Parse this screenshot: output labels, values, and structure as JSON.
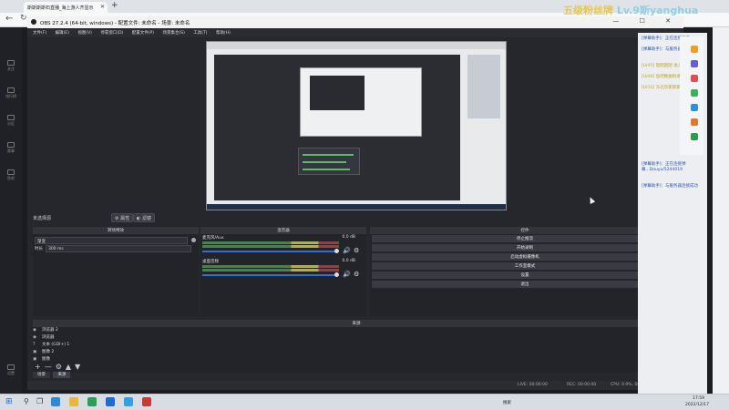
{
  "browser": {
    "tab_title": "斯斯斯斯石直播_海上游人齐显示",
    "new_tab": "+",
    "back": "←",
    "refresh": "↻"
  },
  "banner": {
    "part1": "五级粉丝牌",
    "part2": "Lv.9斯yanghua"
  },
  "obs": {
    "title": "OBS 27.2.4 (64-bit, windows) - 配置文件: 未命名 - 场景: 未命名",
    "window_controls": "— ☐ ✕",
    "menu": [
      "文件(F)",
      "编辑(E)",
      "视图(V)",
      "停靠窗口(D)",
      "配置文件(P)",
      "场景集合(S)",
      "工具(T)",
      "帮助(H)"
    ],
    "no_source": "未选择源",
    "properties_btn": "属性",
    "filters_btn": "滤镜",
    "transition_dock": {
      "header": "转场特效",
      "type": "渐变",
      "duration_label": "时长",
      "duration_value": "300 ms"
    },
    "mixer": {
      "header": "混音器",
      "tracks": [
        {
          "name": "麦克风/Aux",
          "db": "0.0 dB"
        },
        {
          "name": "桌面音频",
          "db": "0.0 dB"
        }
      ]
    },
    "controls": {
      "header": "控件",
      "buttons": [
        "停止推流",
        "开始录制",
        "启动虚拟摄像机",
        "工作室模式",
        "设置",
        "退出"
      ]
    },
    "sources": {
      "header": "来源",
      "items": [
        {
          "icon": "browser",
          "name": "浏览器 2"
        },
        {
          "icon": "browser",
          "name": "浏览器"
        },
        {
          "icon": "text",
          "name": "文本 (GDI+) 1"
        },
        {
          "icon": "image",
          "name": "图像 2"
        },
        {
          "icon": "image",
          "name": "图像"
        }
      ],
      "tabs": [
        "场景",
        "来源"
      ]
    },
    "status": {
      "live": "LIVE: 00:00:00",
      "rec": "REC: 00:00:00",
      "cpu": "CPU: 0.9%, 60.00 fps"
    }
  },
  "sidebar": {
    "items": [
      "关注",
      "排行榜",
      "分区",
      "赛事",
      "鱼吧",
      "设置"
    ]
  },
  "chat": {
    "lines": [
      "[弹幕助手]：正在连接弹幕...",
      "[弹幕助手]：与服务器连接成功",
      "[LV45] 陌陌陌陌 进入直播间",
      "[LV46] 鱼吧数据粉进入直播间",
      "[LV31] 东北玩家斯斯 进入直播间",
      "[弹幕助手]：正在连接弹幕...Douyu/5244019",
      "[弹幕助手]：与服务器连接成功"
    ]
  },
  "taskbar": {
    "search": "搜索",
    "time": "17:59",
    "date": "2022/12/17"
  }
}
